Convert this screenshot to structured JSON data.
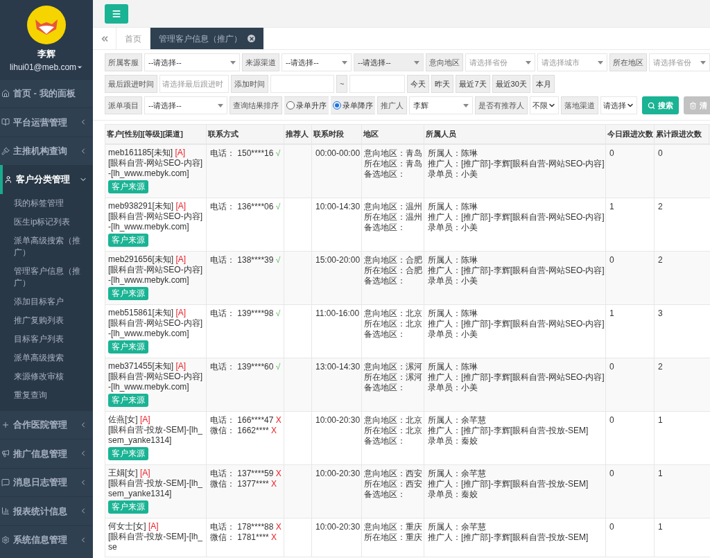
{
  "sidebar": {
    "user": {
      "name": "李辉",
      "email": "lihui01@meb.com"
    },
    "items": [
      {
        "label": "首页 - 我的面板",
        "kind": "link",
        "expanded": false
      },
      {
        "label": "平台运营管理",
        "kind": "group",
        "expanded": false
      },
      {
        "label": "主推机构查询",
        "kind": "group",
        "expanded": false
      },
      {
        "label": "客户分类管理",
        "kind": "group",
        "expanded": true,
        "children": [
          {
            "label": "我的标签管理"
          },
          {
            "label": "医生ip标记列表"
          },
          {
            "label": "派单高级搜索（推广）"
          },
          {
            "label": "管理客户信息（推广）"
          },
          {
            "label": "添加目标客户"
          },
          {
            "label": "推广复购列表"
          },
          {
            "label": "目标客户列表"
          },
          {
            "label": "派单高级搜索"
          },
          {
            "label": "来源修改审核"
          },
          {
            "label": "重复查询"
          }
        ]
      },
      {
        "label": "合作医院管理",
        "kind": "group",
        "expanded": false
      },
      {
        "label": "推广信息管理",
        "kind": "group",
        "expanded": false
      },
      {
        "label": "消息日志管理",
        "kind": "group",
        "expanded": false
      },
      {
        "label": "报表统计信息",
        "kind": "group",
        "expanded": false
      },
      {
        "label": "系统信息管理",
        "kind": "group",
        "expanded": false
      }
    ]
  },
  "tabs": [
    {
      "label": "首页",
      "selected": false,
      "closable": false
    },
    {
      "label": "管理客户信息（推广）",
      "selected": true,
      "closable": true
    }
  ],
  "filters": [
    [
      {
        "kind": "label",
        "text": "所属客服"
      },
      {
        "kind": "select",
        "value": "--请选择--"
      },
      {
        "kind": "label",
        "text": "来源渠道"
      },
      {
        "kind": "select",
        "value": "--请选择--"
      },
      {
        "kind": "select",
        "value": "--请选择--",
        "disabled": true
      },
      {
        "kind": "label",
        "text": "意向地区"
      },
      {
        "kind": "select",
        "placeholder": "请选择省份"
      },
      {
        "kind": "select",
        "placeholder": "请选择城市"
      },
      {
        "kind": "label",
        "text": "所在地区"
      },
      {
        "kind": "select",
        "placeholder": "请选择省份"
      }
    ],
    [
      {
        "kind": "label",
        "text": "最后跟进时间"
      },
      {
        "kind": "input",
        "placeholder": "请选择最后跟进时"
      },
      {
        "kind": "label",
        "text": "添加时间"
      },
      {
        "kind": "input"
      },
      {
        "kind": "label",
        "text": "~"
      },
      {
        "kind": "input"
      },
      {
        "kind": "button",
        "text": "今天"
      },
      {
        "kind": "button",
        "text": "昨天"
      },
      {
        "kind": "button",
        "text": "最近7天"
      },
      {
        "kind": "button",
        "text": "最近30天"
      },
      {
        "kind": "button",
        "text": "本月"
      }
    ],
    [
      {
        "kind": "label",
        "text": "派单项目"
      },
      {
        "kind": "select",
        "value": "--请选择--"
      },
      {
        "kind": "label",
        "text": "查询结果排序"
      },
      {
        "kind": "radio",
        "text": "录单升序",
        "selected": false
      },
      {
        "kind": "radio",
        "text": "录单降序",
        "selected": true
      },
      {
        "kind": "label",
        "text": "推广人"
      },
      {
        "kind": "select",
        "value": "李辉"
      },
      {
        "kind": "label",
        "text": "是否有推荐人"
      },
      {
        "kind": "native",
        "value": "不限"
      },
      {
        "kind": "label",
        "text": "落地渠道"
      },
      {
        "kind": "native",
        "value": "请选择"
      },
      {
        "kind": "search",
        "text": "搜索"
      },
      {
        "kind": "clear",
        "text": "清"
      }
    ]
  ],
  "table": {
    "columns": [
      "客户[性别][等级][渠道]",
      "联系方式",
      "推荐人",
      "联系时段",
      "地区",
      "所属人员",
      "今日跟进次数",
      "累计跟进次数"
    ],
    "rows": [
      {
        "name": "meb161185[未知]",
        "level": "[A]",
        "channel": "[眼科自营-网站SEO-内容]-[lh_www.mebyk.com]",
        "source_button": "客户来源",
        "contacts": [
          {
            "label": "电话：",
            "value": "150****16",
            "mark": "√",
            "verified": true
          }
        ],
        "time": "00:00-00:00",
        "regions": [
          "意向地区：青岛",
          "所在地区：青岛",
          "备选地区："
        ],
        "people": [
          "所属人：陈琳",
          "推广人：[推广部]-李辉[眼科自营-网站SEO-内容]",
          "录单员：小美"
        ],
        "today": "0",
        "total": "0"
      },
      {
        "name": "meb938291[未知]",
        "level": "[A]",
        "channel": "[眼科自营-网站SEO-内容]-[lh_www.mebyk.com]",
        "source_button": "客户来源",
        "contacts": [
          {
            "label": "电话：",
            "value": "136****06",
            "mark": "√",
            "verified": true
          }
        ],
        "time": "10:00-14:30",
        "regions": [
          "意向地区：温州",
          "所在地区：温州",
          "备选地区："
        ],
        "people": [
          "所属人：陈琳",
          "推广人：[推广部]-李辉[眼科自营-网站SEO-内容]",
          "录单员：小美"
        ],
        "today": "1",
        "total": "2"
      },
      {
        "name": "meb291656[未知]",
        "level": "[A]",
        "channel": "[眼科自营-网站SEO-内容]-[lh_www.mebyk.com]",
        "source_button": "客户来源",
        "contacts": [
          {
            "label": "电话：",
            "value": "138****39",
            "mark": "√",
            "verified": true
          }
        ],
        "time": "15:00-20:00",
        "regions": [
          "意向地区：合肥",
          "所在地区：合肥",
          "备选地区："
        ],
        "people": [
          "所属人：陈琳",
          "推广人：[推广部]-李辉[眼科自营-网站SEO-内容]",
          "录单员：小美"
        ],
        "today": "0",
        "total": "2"
      },
      {
        "name": "meb515861[未知]",
        "level": "[A]",
        "channel": "[眼科自营-网站SEO-内容]-[lh_www.mebyk.com]",
        "source_button": "客户来源",
        "contacts": [
          {
            "label": "电话：",
            "value": "139****98",
            "mark": "√",
            "verified": true
          }
        ],
        "time": "11:00-16:00",
        "regions": [
          "意向地区：北京",
          "所在地区：北京",
          "备选地区："
        ],
        "people": [
          "所属人：陈琳",
          "推广人：[推广部]-李辉[眼科自营-网站SEO-内容]",
          "录单员：小美"
        ],
        "today": "1",
        "total": "3"
      },
      {
        "name": "meb371455[未知]",
        "level": "[A]",
        "channel": "[眼科自营-网站SEO-内容]-[lh_www.mebyk.com]",
        "source_button": "客户来源",
        "contacts": [
          {
            "label": "电话：",
            "value": "139****60",
            "mark": "√",
            "verified": true
          }
        ],
        "time": "13:00-14:30",
        "regions": [
          "意向地区：漯河",
          "所在地区：漯河",
          "备选地区："
        ],
        "people": [
          "所属人：陈琳",
          "推广人：[推广部]-李辉[眼科自营-网站SEO-内容]",
          "录单员：小美"
        ],
        "today": "0",
        "total": "2"
      },
      {
        "name": "佐燕[女]",
        "level": "[A]",
        "channel": "[眼科自营-投放-SEM]-[lh_sem_yanke1314]",
        "source_button": "客户来源",
        "contacts": [
          {
            "label": "电话：",
            "value": "166****47",
            "mark": "X",
            "verified": false
          },
          {
            "label": "微信：",
            "value": "1662****",
            "mark": "X",
            "verified": false
          }
        ],
        "time": "10:00-20:30",
        "regions": [
          "意向地区：北京",
          "所在地区：北京",
          "备选地区："
        ],
        "people": [
          "所属人：余芊慧",
          "推广人：[推广部]-李辉[眼科自营-投放-SEM]",
          "录单员：秦姣"
        ],
        "today": "0",
        "total": "1"
      },
      {
        "name": "王娟[女]",
        "level": "[A]",
        "channel": "[眼科自营-投放-SEM]-[lh_sem_yanke1314]",
        "source_button": "客户来源",
        "contacts": [
          {
            "label": "电话：",
            "value": "137****59",
            "mark": "X",
            "verified": false
          },
          {
            "label": "微信：",
            "value": "1377****",
            "mark": "X",
            "verified": false
          }
        ],
        "time": "10:00-20:30",
        "regions": [
          "意向地区：西安",
          "所在地区：西安",
          "备选地区："
        ],
        "people": [
          "所属人：余芊慧",
          "推广人：[推广部]-李辉[眼科自营-投放-SEM]",
          "录单员：秦姣"
        ],
        "today": "0",
        "total": "1"
      },
      {
        "name": "何女士[女]",
        "level": "[A]",
        "channel": "[眼科自营-投放-SEM]-[lh_se",
        "contacts": [
          {
            "label": "电话：",
            "value": "178****88",
            "mark": "X",
            "verified": false
          },
          {
            "label": "微信：",
            "value": "1781****",
            "mark": "X",
            "verified": false
          }
        ],
        "time": "10:00-20:30",
        "regions": [
          "意向地区：重庆",
          "所在地区：重庆"
        ],
        "people": [
          "所属人：余芊慧",
          "推广人：[推广部]-李辉[眼科自营-投放-SEM]"
        ],
        "today": "0",
        "total": "1"
      }
    ]
  }
}
